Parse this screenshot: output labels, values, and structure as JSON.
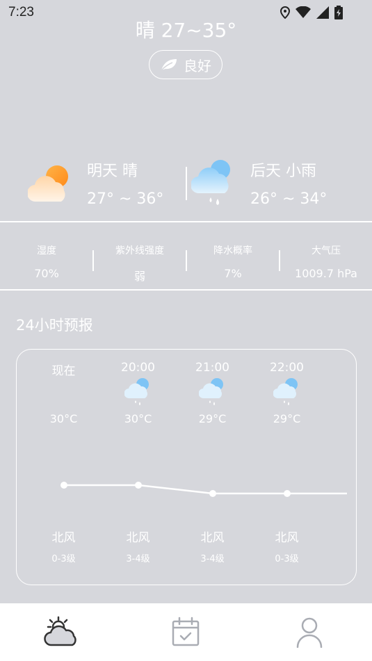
{
  "status_bar": {
    "time": "7:23"
  },
  "summary": {
    "text": "晴 27~35°"
  },
  "aqi": {
    "label": "良好",
    "icon": "leaf-icon"
  },
  "forecast": [
    {
      "title": "明天 晴",
      "temp": "27° ~ 36°",
      "icon": "partly-sunny-icon"
    },
    {
      "title": "后天 小雨",
      "temp": "26° ~ 34°",
      "icon": "light-rain-icon"
    }
  ],
  "metrics": [
    {
      "label": "湿度",
      "value": "70%"
    },
    {
      "label": "紫外线强度",
      "value": "弱"
    },
    {
      "label": "降水概率",
      "value": "7%"
    },
    {
      "label": "大气压",
      "value": "1009.7 hPa"
    }
  ],
  "hourly": {
    "title": "24小时预报",
    "items": [
      {
        "time": "现在",
        "icon": "",
        "temp": "30°C",
        "temp_value": 30,
        "wind": "北风",
        "level": "0-3级"
      },
      {
        "time": "20:00",
        "icon": "light-rain-icon",
        "temp": "30°C",
        "temp_value": 30,
        "wind": "北风",
        "level": "3-4级"
      },
      {
        "time": "21:00",
        "icon": "light-rain-icon",
        "temp": "29°C",
        "temp_value": 29,
        "wind": "北风",
        "level": "3-4级"
      },
      {
        "time": "22:00",
        "icon": "light-rain-icon",
        "temp": "29°C",
        "temp_value": 29,
        "wind": "北风",
        "level": "0-3级"
      }
    ]
  },
  "tabbar": {
    "tabs": [
      {
        "name": "weather",
        "icon": "cloud-sun-icon"
      },
      {
        "name": "calendar",
        "icon": "calendar-check-icon"
      },
      {
        "name": "profile",
        "icon": "user-icon"
      }
    ]
  },
  "colors": {
    "background": "#d6d7dc",
    "text": "#ffffff",
    "accent_orange": "#ff9a2e",
    "accent_blue": "#7ec4f5"
  }
}
